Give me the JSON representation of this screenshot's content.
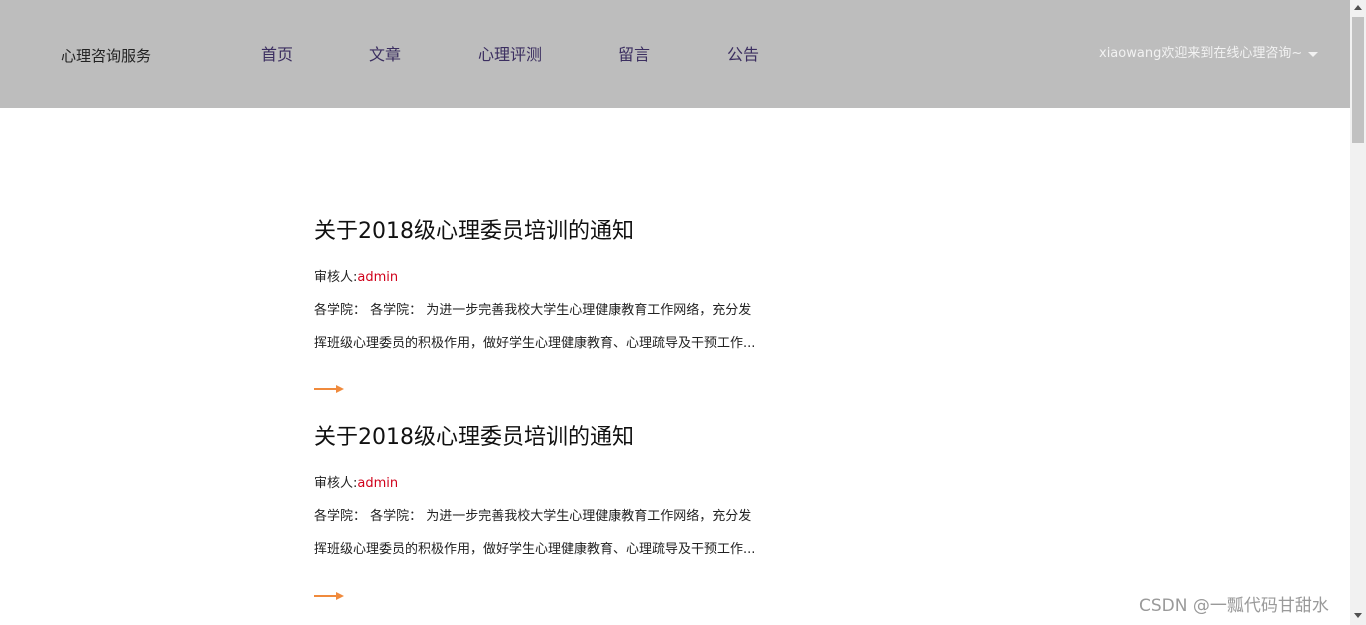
{
  "header": {
    "brand": "心理咨询服务",
    "nav": [
      {
        "label": "首页"
      },
      {
        "label": "文章"
      },
      {
        "label": "心理评测"
      },
      {
        "label": "留言"
      },
      {
        "label": "公告"
      }
    ],
    "user_menu": "xiaowang欢迎来到在线心理咨询~",
    "caret_icon": "chevron-down-icon"
  },
  "articles": [
    {
      "title": "关于2018级心理委员培训的通知",
      "reviewer_label": "审核人:",
      "reviewer_name": "admin",
      "summary_line1": "各学院： 各学院： 为进一步完善我校大学生心理健康教育工作网络，充分发",
      "summary_line2": "挥班级心理委员的积极作用，做好学生心理健康教育、心理疏导及干预工作...",
      "more_icon": "arrow-right-icon"
    },
    {
      "title": "关于2018级心理委员培训的通知",
      "reviewer_label": "审核人:",
      "reviewer_name": "admin",
      "summary_line1": "各学院： 各学院： 为进一步完善我校大学生心理健康教育工作网络，充分发",
      "summary_line2": "挥班级心理委员的积极作用，做好学生心理健康教育、心理疏导及干预工作...",
      "more_icon": "arrow-right-icon"
    }
  ],
  "watermark": "CSDN @一瓢代码甘甜水",
  "colors": {
    "header_bg": "#bdbdbd",
    "nav_text": "#3b2e60",
    "reviewer_name": "#d0021b",
    "arrow": "#f08a3c"
  }
}
